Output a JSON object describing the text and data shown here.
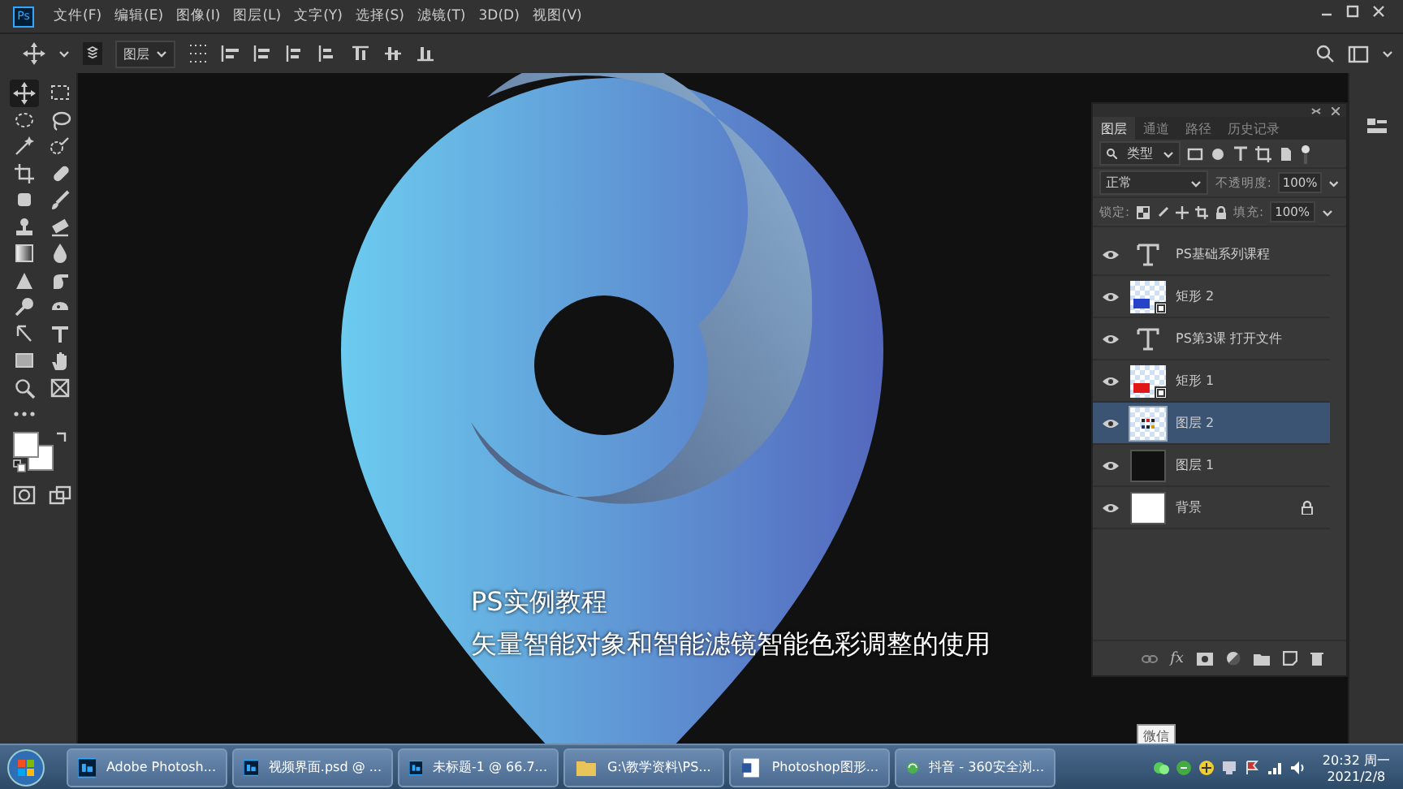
{
  "app_logo": "Ps",
  "menu": [
    "文件(F)",
    "编辑(E)",
    "图像(I)",
    "图层(L)",
    "文字(Y)",
    "选择(S)",
    "滤镜(T)",
    "3D(D)",
    "视图(V)"
  ],
  "options_bar": {
    "target": "图层"
  },
  "tools": [
    {
      "selected": true
    },
    {
      "selected": false
    },
    {
      "selected": false
    },
    {
      "selected": false
    },
    {
      "selected": false
    },
    {
      "selected": false
    },
    {
      "selected": false
    },
    {
      "selected": false
    },
    {
      "selected": false
    },
    {
      "selected": false
    },
    {
      "selected": false
    },
    {
      "selected": false
    },
    {
      "selected": false
    },
    {
      "selected": false
    },
    {
      "selected": false
    },
    {
      "selected": false
    },
    {
      "selected": false
    },
    {
      "selected": false
    },
    {
      "selected": false
    },
    {
      "selected": false
    },
    {
      "selected": false
    },
    {
      "selected": false
    },
    {
      "selected": false
    },
    {
      "selected": false
    }
  ],
  "subtitles": [
    "PS实例教程",
    "矢量智能对象和智能滤镜智能色彩调整的使用"
  ],
  "layers_panel": {
    "tabs": [
      {
        "label": "图层",
        "selected": true
      },
      {
        "label": "通道",
        "selected": false
      },
      {
        "label": "路径",
        "selected": false
      },
      {
        "label": "历史记录",
        "selected": false
      }
    ],
    "filter": "类型",
    "blend_mode": "正常",
    "opacity_label": "不透明度:",
    "opacity": "100%",
    "lock_label": "锁定:",
    "fill_label": "填充:",
    "fill": "100%",
    "effects_label": "fx",
    "layers": [
      {
        "kind": "text",
        "name": "PS基础系列课程",
        "visible": true,
        "selected": false,
        "locked": false
      },
      {
        "kind": "shape",
        "name": "矩形 2",
        "color": "#2443c8",
        "visible": true,
        "selected": false,
        "locked": false
      },
      {
        "kind": "text",
        "name": "PS第3课 打开文件",
        "visible": true,
        "selected": false,
        "locked": false
      },
      {
        "kind": "shape",
        "name": "矩形 1",
        "color": "#e01818",
        "visible": true,
        "selected": false,
        "locked": false
      },
      {
        "kind": "smart",
        "name": "图层 2",
        "visible": true,
        "selected": true,
        "locked": false
      },
      {
        "kind": "pixel",
        "name": "图层 1",
        "color": "#111111",
        "visible": true,
        "selected": false,
        "locked": false
      },
      {
        "kind": "pixel",
        "name": "背景",
        "color": "#ffffff",
        "visible": true,
        "selected": false,
        "locked": true
      }
    ]
  },
  "tooltip": "微信",
  "taskbar": {
    "items": [
      {
        "kind": "ps",
        "label": "Adobe Photosh..."
      },
      {
        "kind": "ps",
        "label": "视频界面.psd @ ..."
      },
      {
        "kind": "ps",
        "label": "未标题-1 @ 66.7..."
      },
      {
        "kind": "folder",
        "label": "G:\\教学资料\\PS..."
      },
      {
        "kind": "document",
        "label": "Photoshop图形..."
      },
      {
        "kind": "browser",
        "label": "抖音 - 360安全浏..."
      }
    ],
    "time": "20:32 周一",
    "date": "2021/2/8"
  }
}
